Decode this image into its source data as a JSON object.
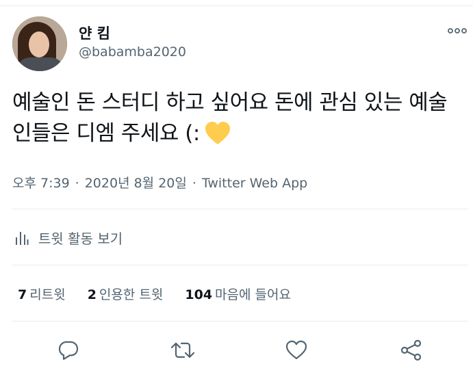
{
  "author": {
    "display_name": "얀 킴",
    "handle": "@babamba2020"
  },
  "tweet": {
    "text": "예술인 돈 스터디 하고 싶어요 돈에 관심 있는 예술인들은 디엠 주세요 (:",
    "emoji": "yellow-heart"
  },
  "meta": {
    "time": "오후 7:39",
    "date": "2020년 8월 20일",
    "separator": "·",
    "source": "Twitter Web App"
  },
  "activity": {
    "label": "트윗 활동 보기"
  },
  "stats": {
    "retweets_count": "7",
    "retweets_label": "리트윗",
    "quotes_count": "2",
    "quotes_label": "인용한 트윗",
    "likes_count": "104",
    "likes_label": "마음에 들어요"
  },
  "actions": {
    "icons": [
      "reply-icon",
      "retweet-icon",
      "like-icon",
      "share-icon"
    ]
  },
  "colors": {
    "text_primary": "#0f1419",
    "text_secondary": "#536471",
    "divider": "#e6ecf0",
    "heart_yellow": "#ffcc4d"
  }
}
